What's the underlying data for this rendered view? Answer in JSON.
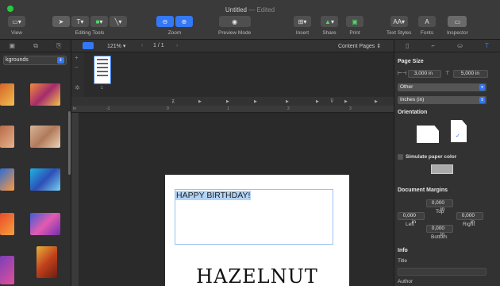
{
  "window": {
    "title": "Untitled",
    "status": "— Edited"
  },
  "toolbar": {
    "view": "View",
    "editing_tools": "Editing Tools",
    "zoom": "Zoom",
    "preview_mode": "Preview Mode",
    "insert": "Insert",
    "share": "Share",
    "print": "Print",
    "text_styles": "Text Styles",
    "fonts": "Fonts",
    "inspector": "Inspector"
  },
  "left": {
    "select_label": "kgrounds"
  },
  "strip": {
    "zoom": "121%",
    "page_counter": "1 / 1",
    "content_pages": "Content Pages",
    "page_number": "1"
  },
  "ruler": {
    "ticks": [
      "in",
      "-1",
      "0",
      "1",
      "2",
      "3"
    ]
  },
  "document": {
    "line1": "HAPPY BIRTHDAY!",
    "line2": "HAZELNUT"
  },
  "inspector": {
    "page_size": "Page Size",
    "width": "3,000 in",
    "height": "5,000 in",
    "paper": "Other",
    "units": "Inches (in)",
    "orientation": "Orientation",
    "simulate": "Simulate paper color",
    "margins": "Document Margins",
    "top_val": "0,000 in",
    "top": "Top",
    "left_val": "0,000 in",
    "left": "Left",
    "right_val": "0,000 in",
    "right": "Right",
    "bottom_val": "0,000 in",
    "bottom": "Bottom",
    "info": "Info",
    "title": "Title",
    "author": "Author"
  },
  "colors": {
    "accent": "#3478f6",
    "selection": "#b3d3f5"
  }
}
